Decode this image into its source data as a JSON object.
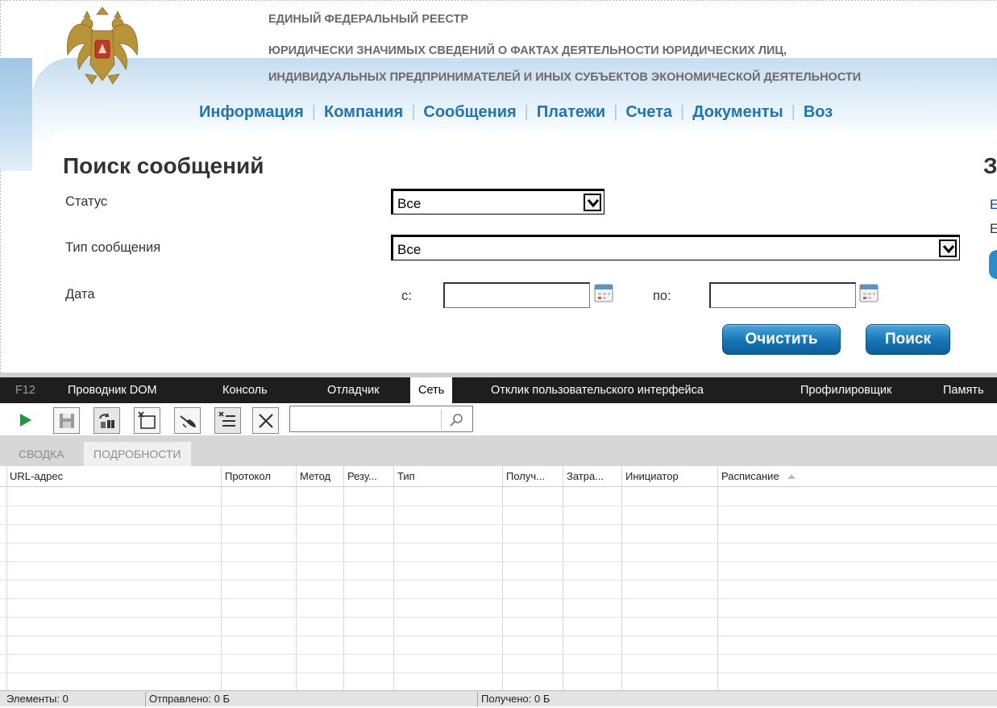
{
  "header": {
    "registry_lines": [
      "ЕДИНЫЙ ФЕДЕРАЛЬНЫЙ РЕЕСТР",
      "ЮРИДИЧЕСКИ ЗНАЧИМЫХ СВЕДЕНИЙ О ФАКТАХ ДЕЯТЕЛЬНОСТИ ЮРИДИЧЕСКИХ ЛИЦ,",
      "ИНДИВИДУАЛЬНЫХ ПРЕДПРИНИМАТЕЛЕЙ И ИНЫХ СУБЪЕКТОВ ЭКОНОМИЧЕСКОЙ ДЕЯТЕЛЬНОСТИ"
    ],
    "nav": [
      "Информация",
      "Компания",
      "Сообщения",
      "Платежи",
      "Счета",
      "Документы",
      "Воз"
    ]
  },
  "search_form": {
    "title": "Поиск сообщений",
    "status_label": "Статус",
    "status_value": "Все",
    "type_label": "Тип сообщения",
    "type_value": "Все",
    "date_label": "Дата",
    "from_label": "с:",
    "to_label": "по:",
    "from_value": "",
    "to_value": "",
    "clear_button": "Очистить",
    "search_button": "Поиск"
  },
  "right_panel": {
    "cut_title": "З",
    "cut_link": "Е",
    "cut_text": "Е"
  },
  "devtools": {
    "f12": "F12",
    "tabs": [
      "Проводник DOM",
      "Консоль",
      "Отладчик",
      "Сеть",
      "Отклик пользовательского интерфейса",
      "Профилировщик",
      "Память"
    ],
    "active_tab": "Сеть",
    "search_value": "",
    "subtabs": [
      "СВОДКА",
      "ПОДРОБНОСТИ"
    ],
    "columns": [
      "URL-адрес",
      "Протокол",
      "Метод",
      "Резу...",
      "Тип",
      "Получ...",
      "Затра...",
      "Инициатор",
      "Расписание"
    ],
    "status": {
      "items": "Элементы: 0",
      "sent": "Отправлено: 0 Б",
      "received": "Получено: 0 Б"
    }
  }
}
